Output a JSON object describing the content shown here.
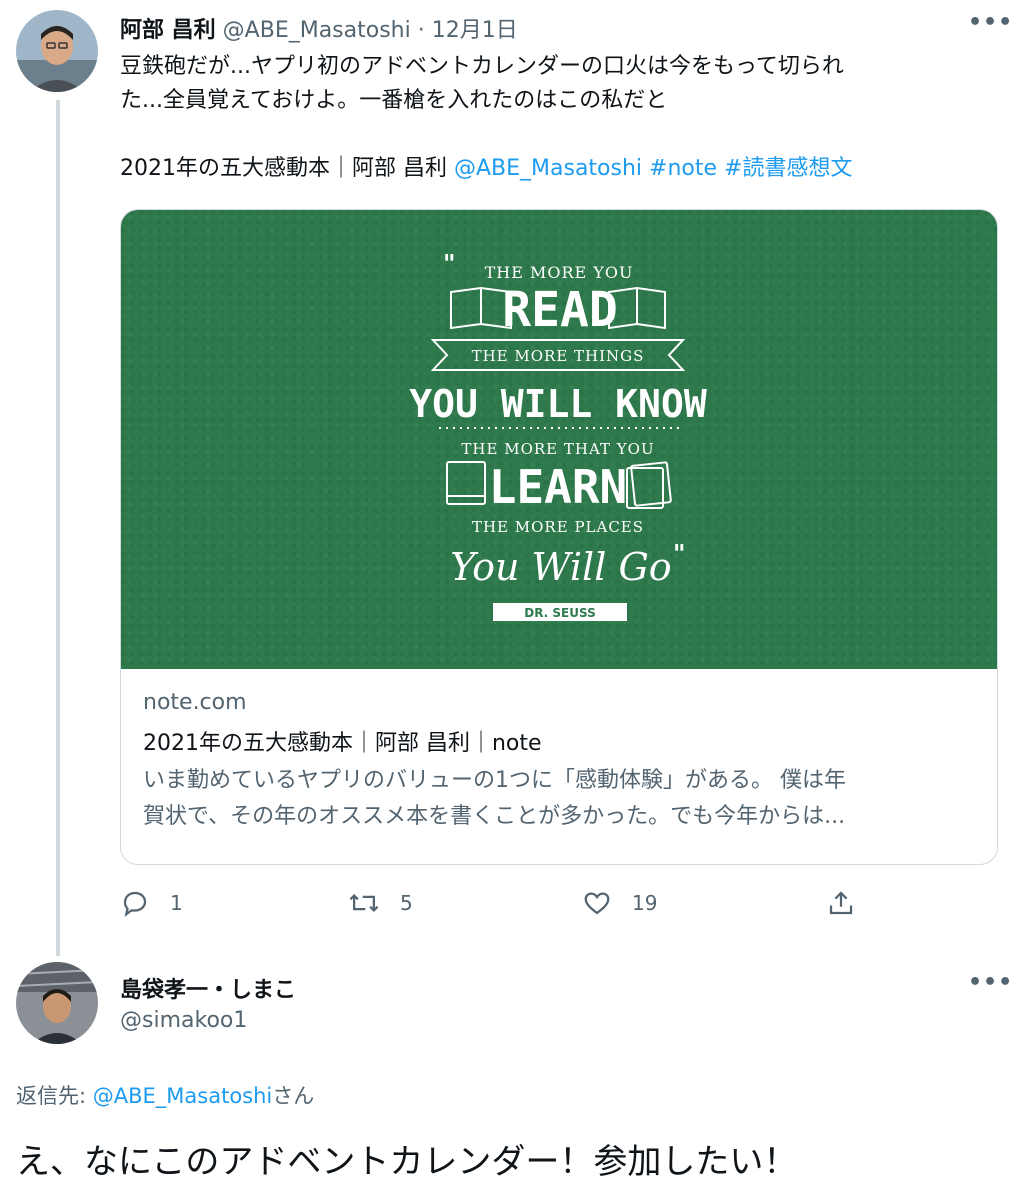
{
  "tweet1": {
    "author_name": "阿部 昌利",
    "handle": "@ABE_Masatoshi",
    "separator": "·",
    "date": "12月1日",
    "more": "•••",
    "text_line1": "豆鉄砲だが...ヤプリ初のアドベントカレンダーの口火は今をもって切られ",
    "text_line2": "た...全員覚えておけよ。一番槍を入れたのはこの私だと",
    "text_line3_plain": "2021年の五大感動本｜阿部 昌利 ",
    "mention": "@ABE_Masatoshi",
    "hashtag1": "#note",
    "hashtag2": "#読書感想文",
    "card": {
      "image_quote": {
        "line1": "THE MORE YOU",
        "line2": "READ",
        "line3": "THE MORE THINGS",
        "line4": "YOU WILL KNOW",
        "line5": "THE MORE THAT YOU",
        "line6": "LEARN",
        "line7": "THE MORE PLACES",
        "line8": "You Will Go",
        "author": "DR. SEUSS"
      },
      "domain": "note.com",
      "title": "2021年の五大感動本｜阿部 昌利｜note",
      "desc_line1": "いま勤めているヤプリのバリューの1つに「感動体験」がある。 僕は年",
      "desc_line2": "賀状で、その年のオススメ本を書くことが多かった。でも今年からは..."
    },
    "actions": {
      "replies": "1",
      "retweets": "5",
      "likes": "19"
    }
  },
  "tweet2": {
    "author_name": "島袋孝一・しまこ",
    "handle": "@simakoo1",
    "more": "•••",
    "reply_label": "返信先: ",
    "reply_mention": "@ABE_Masatoshi",
    "reply_suffix": "さん",
    "text": "え、なにこのアドベントカレンダー！参加したい！"
  },
  "colors": {
    "link": "#1d9bf0",
    "muted": "#536471",
    "card_green": "#2e7a4c"
  }
}
